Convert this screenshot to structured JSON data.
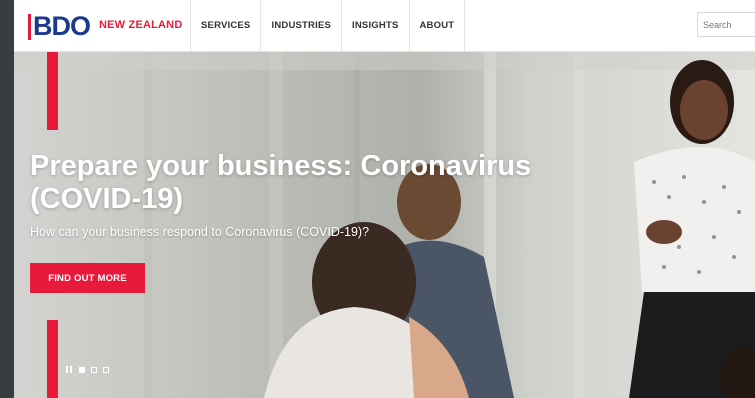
{
  "logo": {
    "text": "BDO",
    "region": "NEW ZEALAND"
  },
  "nav": {
    "items": [
      {
        "label": "SERVICES"
      },
      {
        "label": "INDUSTRIES"
      },
      {
        "label": "INSIGHTS"
      },
      {
        "label": "ABOUT"
      }
    ]
  },
  "search": {
    "placeholder": "Search"
  },
  "hero": {
    "title": "Prepare your business: Coronavirus (COVID-19)",
    "subtitle": "How can your business respond to Coronavirus (COVID-19)?",
    "cta_label": "FIND OUT MORE"
  },
  "carousel": {
    "slide_count": 3,
    "active_index": 0
  },
  "colors": {
    "brand_red": "#e81a3b",
    "brand_blue": "#1b3a8c"
  }
}
